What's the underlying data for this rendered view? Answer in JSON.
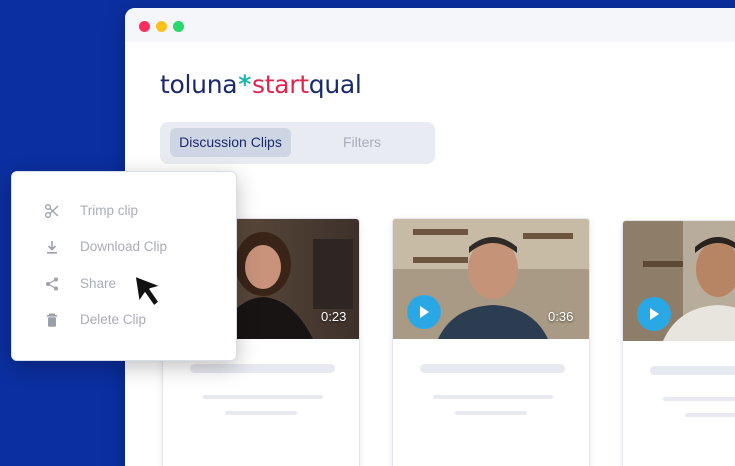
{
  "window": {
    "traffic_lights": [
      "#ff2d5d",
      "#ffc21a",
      "#2bd66b"
    ]
  },
  "logo": {
    "part1": "toluna",
    "star": "*",
    "part2": "start",
    "part3": "qual"
  },
  "tabs": {
    "active_label": "Discussion Clips",
    "filters_label": "Filters"
  },
  "clips": [
    {
      "duration": "0:23"
    },
    {
      "duration": "0:36"
    },
    {
      "duration": ""
    }
  ],
  "context_menu": {
    "items": [
      {
        "label": "Trimp clip",
        "icon": "scissors-icon"
      },
      {
        "label": "Download Clip",
        "icon": "download-icon"
      },
      {
        "label": "Share",
        "icon": "share-icon"
      },
      {
        "label": "Delete Clip",
        "icon": "trash-icon"
      }
    ]
  },
  "colors": {
    "background": "#0b2fa0",
    "play_button": "#2aa8e6",
    "brand_navy": "#1a2a6c",
    "brand_red": "#e0254f",
    "brand_teal": "#1db5b0"
  }
}
